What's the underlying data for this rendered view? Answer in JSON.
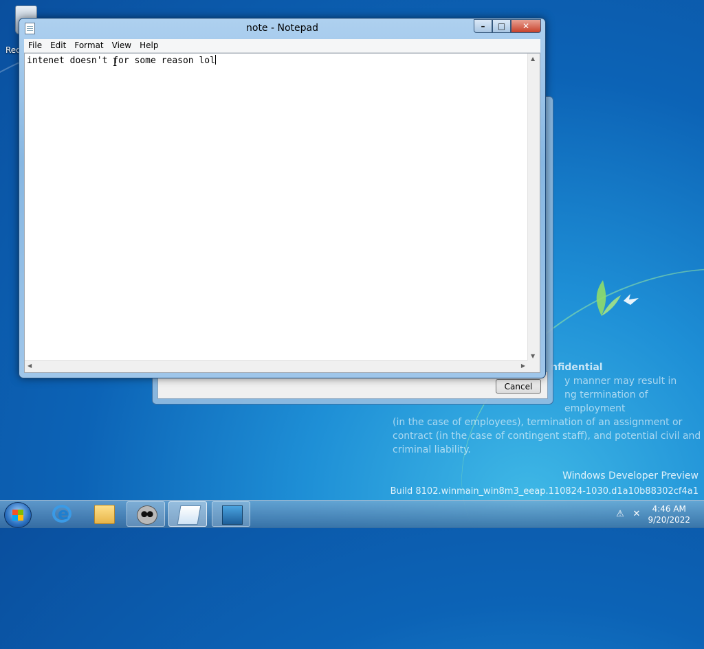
{
  "desktop": {
    "recycle_bin_label": "Rec",
    "confidential": {
      "heading": "nfidential",
      "lines": [
        "y manner may result in",
        "ng termination of employment",
        "(in the case of employees), termination of an assignment or",
        "contract (in the case of contingent staff), and potential civil and",
        "criminal liability."
      ]
    },
    "watermark": {
      "line1": "Windows Developer Preview",
      "line2": "Build 8102.winmain_win8m3_eeap.110824-1030.d1a10b88302cf4a1"
    }
  },
  "background_dialog": {
    "cancel_label": "Cancel"
  },
  "notepad": {
    "title": "note - Notepad",
    "menu": [
      "File",
      "Edit",
      "Format",
      "View",
      "Help"
    ],
    "content": "intenet doesn't for some reason lol",
    "caption_buttons": {
      "minimize": "–",
      "maximize": "□",
      "close": "✕"
    }
  },
  "taskbar": {
    "apps": [
      {
        "name": "internet-explorer",
        "state": "pinned"
      },
      {
        "name": "file-explorer",
        "state": "pinned"
      },
      {
        "name": "raccoon-app",
        "state": "running"
      },
      {
        "name": "notepad",
        "state": "active"
      },
      {
        "name": "remote-desktop",
        "state": "running"
      }
    ],
    "clock": {
      "time": "4:46 AM",
      "date": "9/20/2022"
    }
  },
  "colors": {
    "desktop": "#0c63b6",
    "window_frame": "#9fc6ea",
    "close_button": "#c8412a"
  }
}
